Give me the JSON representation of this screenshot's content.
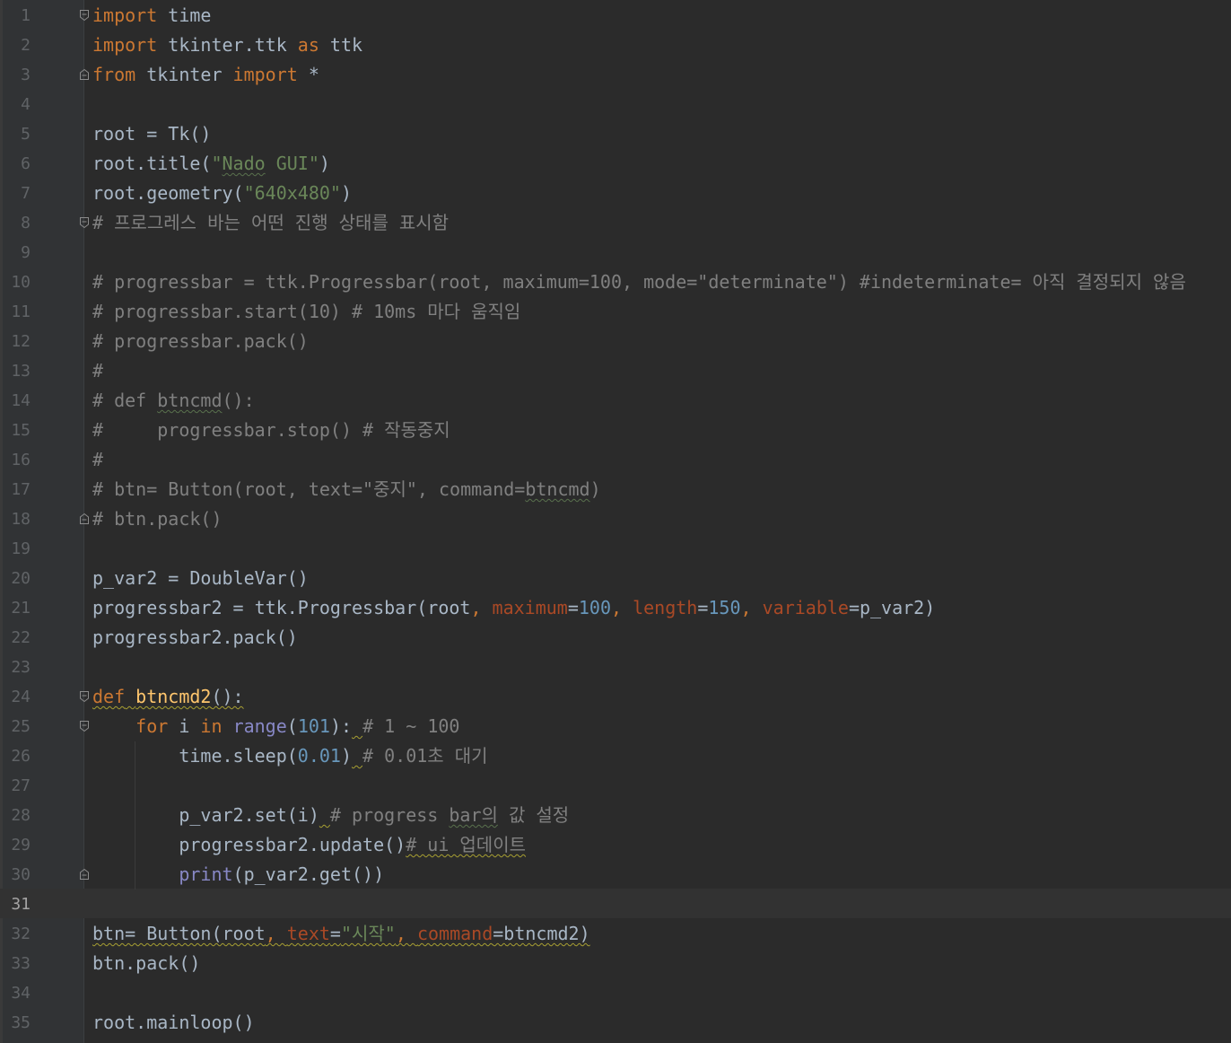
{
  "editor": {
    "current_line": 31,
    "colors": {
      "background": "#2b2b2b",
      "gutter": "#313335",
      "keyword": "#cc7832",
      "string": "#6a8759",
      "comment": "#808080",
      "number": "#6897bb",
      "param": "#aa4926",
      "function": "#ffc66d",
      "builtin": "#8888c6",
      "text": "#a9b7c6"
    },
    "lines": [
      {
        "n": "1",
        "fold": "open",
        "t": [
          [
            "import",
            "kw"
          ],
          [
            " time",
            ""
          ]
        ]
      },
      {
        "n": "2",
        "t": [
          [
            "import",
            "kw"
          ],
          [
            " tkinter.ttk ",
            ""
          ],
          [
            "as",
            "kw"
          ],
          [
            " ttk",
            ""
          ]
        ]
      },
      {
        "n": "3",
        "fold": "close",
        "t": [
          [
            "from",
            "kw"
          ],
          [
            " tkinter ",
            ""
          ],
          [
            "import",
            "kw"
          ],
          [
            " *",
            ""
          ]
        ]
      },
      {
        "n": "4",
        "t": []
      },
      {
        "n": "5",
        "t": [
          [
            "root = Tk()",
            ""
          ]
        ]
      },
      {
        "n": "6",
        "t": [
          [
            "root.title(",
            ""
          ],
          [
            "\"",
            "str"
          ],
          [
            "Nado",
            "str sq"
          ],
          [
            " GUI\"",
            "str"
          ],
          [
            ")",
            ""
          ]
        ]
      },
      {
        "n": "7",
        "t": [
          [
            "root.geometry(",
            ""
          ],
          [
            "\"640x480\"",
            "str"
          ],
          [
            ")",
            ""
          ]
        ]
      },
      {
        "n": "8",
        "fold": "open",
        "t": [
          [
            "# 프로그레스 바는 어떤 진행 상태를 표시함",
            "cmt"
          ]
        ]
      },
      {
        "n": "9",
        "t": []
      },
      {
        "n": "10",
        "t": [
          [
            "# progressbar = ttk.Progressbar(root, maximum=100, mode=\"determinate\") #indeterminate= 아직 결정되지 않음",
            "cmt"
          ]
        ]
      },
      {
        "n": "11",
        "t": [
          [
            "# progressbar.start(10) # 10ms 마다 움직임",
            "cmt"
          ]
        ]
      },
      {
        "n": "12",
        "t": [
          [
            "# progressbar.pack()",
            "cmt"
          ]
        ]
      },
      {
        "n": "13",
        "t": [
          [
            "#",
            "cmt"
          ]
        ]
      },
      {
        "n": "14",
        "t": [
          [
            "# def ",
            "cmt"
          ],
          [
            "btncmd",
            "cmt sq"
          ],
          [
            "():",
            "cmt"
          ]
        ]
      },
      {
        "n": "15",
        "t": [
          [
            "#     progressbar.stop() # 작동중지",
            "cmt"
          ]
        ]
      },
      {
        "n": "16",
        "t": [
          [
            "#",
            "cmt"
          ]
        ]
      },
      {
        "n": "17",
        "t": [
          [
            "# btn= Button(root, text=\"중지\", command=",
            "cmt"
          ],
          [
            "btncmd",
            "cmt sq"
          ],
          [
            ")",
            "cmt"
          ]
        ]
      },
      {
        "n": "18",
        "fold": "close",
        "t": [
          [
            "# btn.pack()",
            "cmt"
          ]
        ]
      },
      {
        "n": "19",
        "t": []
      },
      {
        "n": "20",
        "t": [
          [
            "p_var2 = DoubleVar()",
            ""
          ]
        ]
      },
      {
        "n": "21",
        "t": [
          [
            "progressbar2 = ttk.Progressbar(root",
            ""
          ],
          [
            ", ",
            "kw"
          ],
          [
            "maximum",
            "param"
          ],
          [
            "=",
            ""
          ],
          [
            "100",
            "num"
          ],
          [
            ", ",
            "kw"
          ],
          [
            "length",
            "param"
          ],
          [
            "=",
            ""
          ],
          [
            "150",
            "num"
          ],
          [
            ", ",
            "kw"
          ],
          [
            "variable",
            "param"
          ],
          [
            "=p_var2)",
            ""
          ]
        ]
      },
      {
        "n": "22",
        "t": [
          [
            "progressbar2.pack()",
            ""
          ]
        ]
      },
      {
        "n": "23",
        "t": []
      },
      {
        "n": "24",
        "fold": "open",
        "t": [
          [
            "def",
            "kw sqw"
          ],
          [
            " ",
            "sqw"
          ],
          [
            "btncmd2",
            "fn sqw"
          ],
          [
            "():",
            "sqw"
          ]
        ]
      },
      {
        "n": "25",
        "fold": "open",
        "t": [
          [
            "    ",
            ""
          ],
          [
            "for",
            "kw"
          ],
          [
            " i ",
            ""
          ],
          [
            "in",
            "kw"
          ],
          [
            " ",
            ""
          ],
          [
            "range",
            "bi"
          ],
          [
            "(",
            ""
          ],
          [
            "101",
            "num"
          ],
          [
            "):",
            ""
          ],
          [
            " ",
            "sqw"
          ],
          [
            "# 1 ~ 100",
            "cmt"
          ]
        ]
      },
      {
        "n": "26",
        "t": [
          [
            "        time.sleep(",
            ""
          ],
          [
            "0.01",
            "num"
          ],
          [
            ")",
            ""
          ],
          [
            " ",
            "sqw"
          ],
          [
            "# 0.01초 대기",
            "cmt"
          ]
        ]
      },
      {
        "n": "27",
        "t": []
      },
      {
        "n": "28",
        "t": [
          [
            "        p_var2.set(i)",
            ""
          ],
          [
            " ",
            "sqw"
          ],
          [
            "# progress ",
            "cmt"
          ],
          [
            "bar의",
            "cmt sq"
          ],
          [
            " 값 설정",
            "cmt"
          ]
        ]
      },
      {
        "n": "29",
        "t": [
          [
            "        progressbar2.update()",
            ""
          ],
          [
            "# ui 업데이트",
            "cmt sqw"
          ]
        ]
      },
      {
        "n": "30",
        "fold": "close",
        "t": [
          [
            "        ",
            ""
          ],
          [
            "print",
            "bi"
          ],
          [
            "(p_var2.get())",
            ""
          ]
        ]
      },
      {
        "n": "31",
        "t": []
      },
      {
        "n": "32",
        "t": [
          [
            "btn= Button(root",
            "sqw"
          ],
          [
            ", ",
            "kw sqw"
          ],
          [
            "text",
            "param sqw"
          ],
          [
            "=",
            "sqw"
          ],
          [
            "\"시작\"",
            "str sqw"
          ],
          [
            ", ",
            "kw sqw"
          ],
          [
            "command",
            "param sqw"
          ],
          [
            "=btncmd2)",
            "sqw"
          ]
        ]
      },
      {
        "n": "33",
        "t": [
          [
            "btn.pack()",
            ""
          ]
        ]
      },
      {
        "n": "34",
        "t": []
      },
      {
        "n": "35",
        "t": [
          [
            "root.mainloop()",
            ""
          ]
        ]
      }
    ]
  }
}
